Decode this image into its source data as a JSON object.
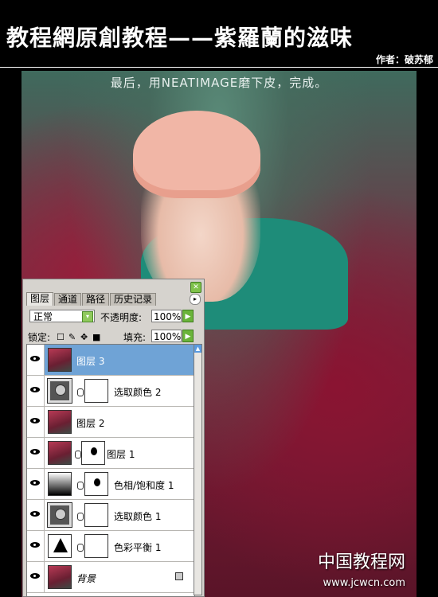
{
  "header": {
    "title": "教程網原創教程——紫羅蘭的滋味",
    "author": "作者：破苏郁"
  },
  "photo": {
    "caption": "最后，用NEATIMAGE磨下皮，完成。"
  },
  "palette": {
    "tabs": [
      "图层",
      "通道",
      "路径",
      "历史记录"
    ],
    "blend_mode": "正常",
    "opacity_label": "不透明度:",
    "opacity_value": "100%",
    "lock_label": "锁定:",
    "fill_label": "填充:",
    "fill_value": "100%",
    "layers": [
      {
        "name": "图层 3",
        "selected": true
      },
      {
        "name": "选取颜色 2"
      },
      {
        "name": "图层 2"
      },
      {
        "name": "图层 1"
      },
      {
        "name": "色相/饱和度 1"
      },
      {
        "name": "选取颜色 1"
      },
      {
        "name": "色彩平衡 1"
      },
      {
        "name": "背景"
      }
    ]
  },
  "watermark": {
    "line1": "中国教程网",
    "line2": "www.jcwcn.com"
  }
}
